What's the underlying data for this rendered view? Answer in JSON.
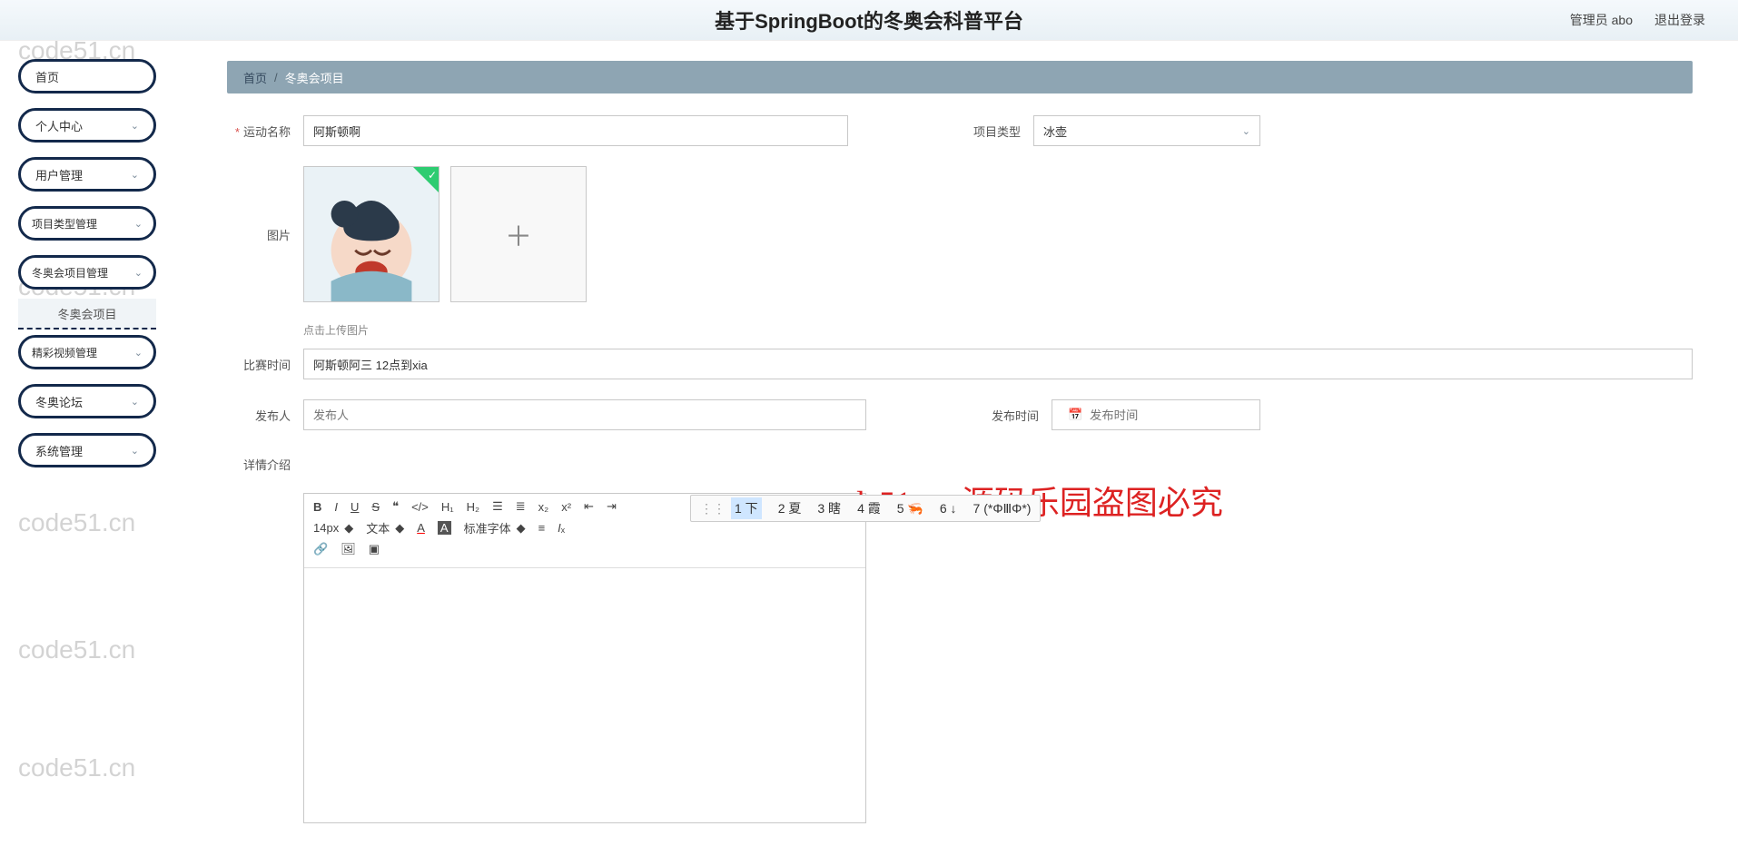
{
  "header": {
    "title": "基于SpringBoot的冬奥会科普平台",
    "user_label": "管理员 abo",
    "logout": "退出登录"
  },
  "sidebar": {
    "items": [
      {
        "label": "首页",
        "expandable": false
      },
      {
        "label": "个人中心",
        "expandable": true
      },
      {
        "label": "用户管理",
        "expandable": true
      },
      {
        "label": "项目类型管理",
        "expandable": true
      },
      {
        "label": "冬奥会项目管理",
        "expandable": true,
        "sub": "冬奥会项目"
      },
      {
        "label": "精彩视频管理",
        "expandable": true
      },
      {
        "label": "冬奥论坛",
        "expandable": true
      },
      {
        "label": "系统管理",
        "expandable": true
      }
    ]
  },
  "breadcrumb": {
    "home": "首页",
    "current": "冬奥会项目"
  },
  "form": {
    "sport_name_label": "运动名称",
    "sport_name_value": "阿斯顿啊",
    "type_label": "项目类型",
    "type_value": "冰壶",
    "pic_label": "图片",
    "pic_hint": "点击上传图片",
    "match_time_label": "比赛时间",
    "match_time_value": "阿斯顿阿三 12点到xia",
    "publisher_label": "发布人",
    "publisher_placeholder": "发布人",
    "pub_time_label": "发布时间",
    "pub_time_placeholder": "发布时间",
    "detail_label": "详情介绍"
  },
  "ime": {
    "candidates": [
      "1 下",
      "2 夏",
      "3 瞎",
      "4 霞",
      "5 🦐",
      "6 ↓",
      "7 (*ΦⅢΦ*)"
    ]
  },
  "editor_toolbar": {
    "fontsize": "14px",
    "paragraph": "文本",
    "fontfamily": "标准字体"
  },
  "overlay_text": "code51.cn-源码乐园盗图必究",
  "watermark": "code51.cn"
}
